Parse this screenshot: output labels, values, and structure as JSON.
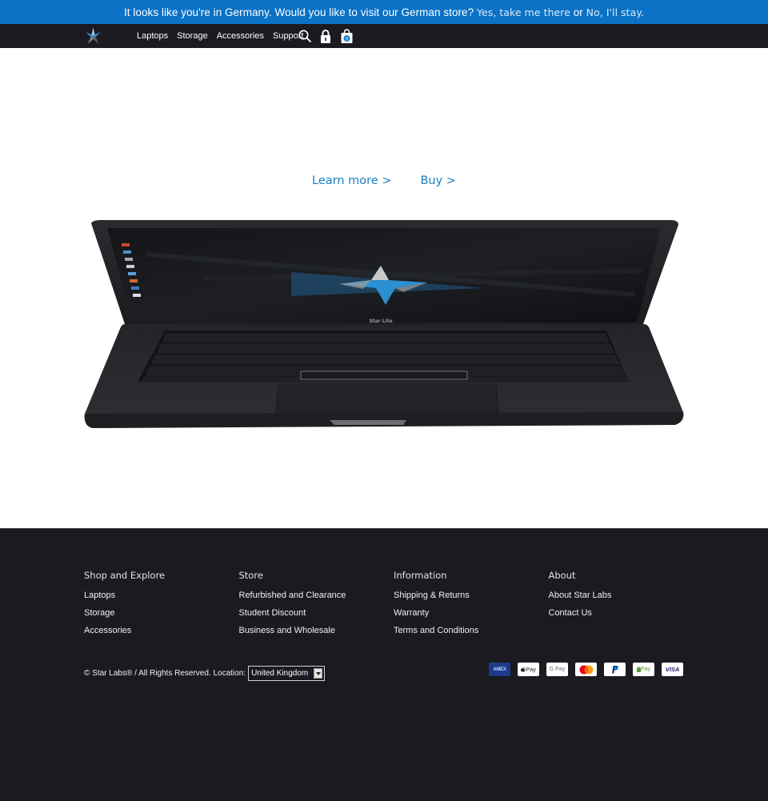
{
  "geo_banner": {
    "message": "It looks like you're in Germany. Would you like to visit our German store?",
    "yes_label": "Yes, take me there",
    "or_text": "or",
    "no_label": "No, I'll stay."
  },
  "nav": {
    "logo_icon": "star-labs-logo",
    "items": [
      {
        "label": "Laptops"
      },
      {
        "label": "Storage"
      },
      {
        "label": "Accessories"
      },
      {
        "label": "Support"
      }
    ],
    "icons": [
      "search-icon",
      "lock-icon",
      "cart-icon"
    ],
    "cart_count": "0"
  },
  "hero": {
    "learn_more_label": "Learn more >",
    "buy_label": "Buy >",
    "product_image": "laptop-product-image",
    "screen_label": "Star Lite"
  },
  "footer": {
    "columns": [
      {
        "heading": "Shop and Explore",
        "links": [
          {
            "label": "Laptops"
          },
          {
            "label": "Storage"
          },
          {
            "label": "Accessories"
          }
        ]
      },
      {
        "heading": "Store",
        "links": [
          {
            "label": "Refurbished and Clearance"
          },
          {
            "label": "Student Discount"
          },
          {
            "label": "Business and Wholesale"
          }
        ]
      },
      {
        "heading": "Information",
        "links": [
          {
            "label": "Shipping & Returns"
          },
          {
            "label": "Warranty"
          },
          {
            "label": "Terms and Conditions"
          }
        ]
      },
      {
        "heading": "About",
        "links": [
          {
            "label": "About Star Labs"
          },
          {
            "label": "Contact Us"
          }
        ]
      }
    ],
    "copyright": "© Star Labs® / All Rights Reserved. Location:",
    "location_value": "United Kingdom",
    "payments": [
      {
        "name": "amex",
        "label": "AMEX"
      },
      {
        "name": "apple-pay",
        "label": "Pay"
      },
      {
        "name": "google-pay",
        "label": "G Pay"
      },
      {
        "name": "mastercard",
        "label": ""
      },
      {
        "name": "paypal",
        "label": "P"
      },
      {
        "name": "shop-pay",
        "label": "Pay"
      },
      {
        "name": "visa",
        "label": "VISA"
      }
    ]
  },
  "colors": {
    "banner_bg": "#0b72c6",
    "nav_bg": "#1b1a21",
    "cta_link": "#1a7fbf",
    "footer_bg": "#1b1a21"
  }
}
